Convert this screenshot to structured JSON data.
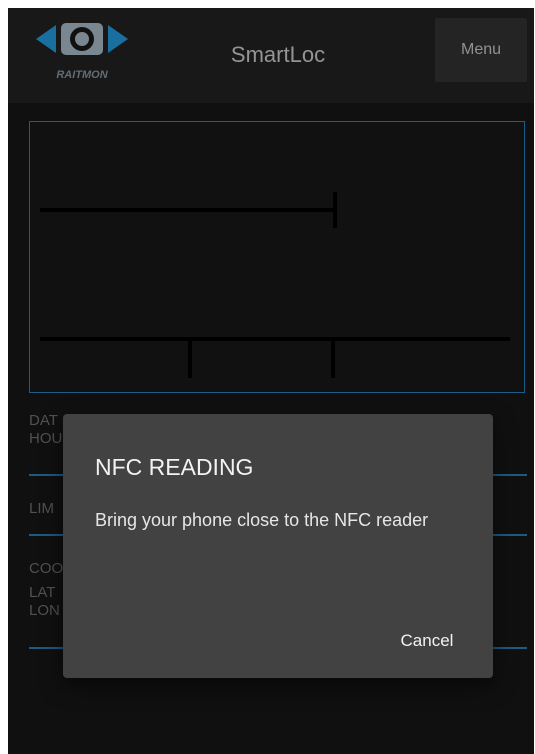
{
  "app_bar": {
    "logo_text": "RAITMON",
    "title": "SmartLoc",
    "menu_label": "Menu"
  },
  "info": {
    "date_label": "DAT",
    "hour_label": "HOU",
    "limit_label": "LIM",
    "coord_label": "COO",
    "lat_label": "LAT",
    "lon_label": "LON"
  },
  "dialog": {
    "title": "NFC READING",
    "message": "Bring your phone close to the NFC reader",
    "cancel_label": "Cancel"
  },
  "colors": {
    "accent": "#1f6897",
    "background": "#131313",
    "dialog": "#424242"
  },
  "icons": {
    "logo": "raitmon-eye-logo"
  }
}
